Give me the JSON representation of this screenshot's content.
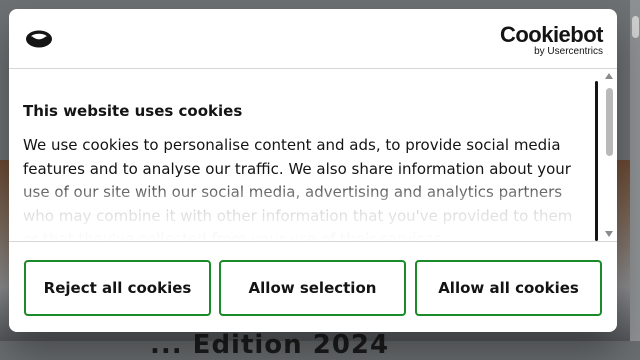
{
  "dialog": {
    "brand": {
      "name": "Cookiebot",
      "byline": "by Usercentrics"
    },
    "title": "This website uses cookies",
    "text": "We use cookies to personalise content and ads, to provide social media features and to analyse our traffic. We also share information about your use of our site with our social media, advertising and analytics partners who may combine it with other information that you've provided to them or that they've collected from your use of their services.",
    "buttons": {
      "reject": "Reject all cookies",
      "selection": "Allow selection",
      "allow": "Allow all cookies"
    },
    "accent_color": "#1a8a2a"
  },
  "background_page": {
    "heading": "... Edition 2024"
  }
}
